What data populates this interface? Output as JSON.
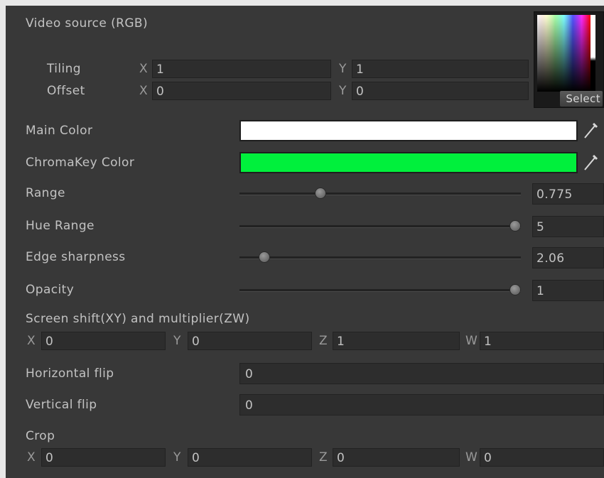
{
  "texture": {
    "label": "Video source (RGB)",
    "tiling_label": "Tiling",
    "offset_label": "Offset",
    "tiling_x": "1",
    "tiling_y": "1",
    "offset_x": "0",
    "offset_y": "0",
    "select_label": "Select"
  },
  "axes": {
    "x": "X",
    "y": "Y",
    "z": "Z",
    "w": "W"
  },
  "colors": {
    "main_label": "Main Color",
    "main_value": "#ffffff",
    "chroma_label": "ChromaKey Color",
    "chroma_value": "#00f03c"
  },
  "sliders": [
    {
      "label": "Range",
      "value": "0.775",
      "fraction": 0.28
    },
    {
      "label": "Hue Range",
      "value": "5",
      "fraction": 1.0
    },
    {
      "label": "Edge sharpness",
      "value": "2.06",
      "fraction": 0.07
    },
    {
      "label": "Opacity",
      "value": "1",
      "fraction": 1.0
    }
  ],
  "screen_shift": {
    "label": "Screen shift(XY) and multiplier(ZW)",
    "x": "0",
    "y": "0",
    "z": "1",
    "w": "1"
  },
  "flips": {
    "horizontal_label": "Horizontal flip",
    "horizontal_value": "0",
    "vertical_label": "Vertical flip",
    "vertical_value": "0"
  },
  "crop": {
    "label": "Crop",
    "x": "0",
    "y": "0",
    "z": "0",
    "w": "0"
  }
}
